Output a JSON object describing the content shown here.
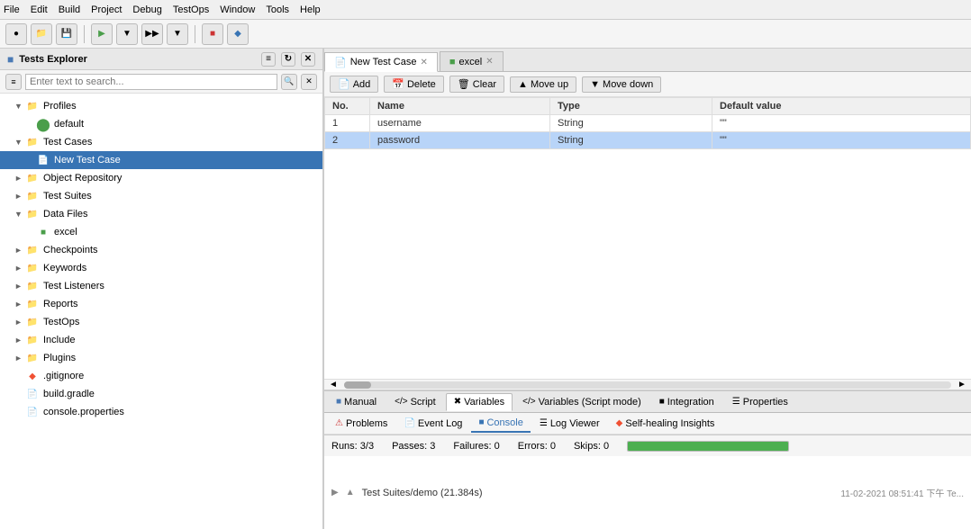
{
  "menubar": {
    "items": [
      "File",
      "Edit",
      "Build",
      "Project",
      "Debug",
      "TestOps",
      "Window",
      "Tools",
      "Help"
    ]
  },
  "left_panel": {
    "title": "Tests Explorer",
    "search_placeholder": "Enter text to search...",
    "tree": [
      {
        "id": "profiles",
        "label": "Profiles",
        "indent": 1,
        "expanded": true,
        "icon": "folder",
        "has_arrow": true
      },
      {
        "id": "default",
        "label": "default",
        "indent": 2,
        "expanded": false,
        "icon": "default-dot",
        "has_arrow": false
      },
      {
        "id": "test-cases",
        "label": "Test Cases",
        "indent": 1,
        "expanded": true,
        "icon": "folder",
        "has_arrow": true
      },
      {
        "id": "new-test-case",
        "label": "New Test Case",
        "indent": 2,
        "expanded": false,
        "icon": "testcase",
        "has_arrow": false,
        "selected": true
      },
      {
        "id": "object-repository",
        "label": "Object Repository",
        "indent": 1,
        "expanded": false,
        "icon": "folder",
        "has_arrow": true
      },
      {
        "id": "test-suites",
        "label": "Test Suites",
        "indent": 1,
        "expanded": false,
        "icon": "folder",
        "has_arrow": true
      },
      {
        "id": "data-files",
        "label": "Data Files",
        "indent": 1,
        "expanded": true,
        "icon": "folder",
        "has_arrow": true
      },
      {
        "id": "excel",
        "label": "excel",
        "indent": 2,
        "expanded": false,
        "icon": "excel",
        "has_arrow": false
      },
      {
        "id": "checkpoints",
        "label": "Checkpoints",
        "indent": 1,
        "expanded": false,
        "icon": "folder",
        "has_arrow": true
      },
      {
        "id": "keywords",
        "label": "Keywords",
        "indent": 1,
        "expanded": false,
        "icon": "folder",
        "has_arrow": true
      },
      {
        "id": "test-listeners",
        "label": "Test Listeners",
        "indent": 1,
        "expanded": false,
        "icon": "folder",
        "has_arrow": true
      },
      {
        "id": "reports",
        "label": "Reports",
        "indent": 1,
        "expanded": false,
        "icon": "folder",
        "has_arrow": true
      },
      {
        "id": "testops",
        "label": "TestOps",
        "indent": 1,
        "expanded": false,
        "icon": "folder",
        "has_arrow": true
      },
      {
        "id": "include",
        "label": "Include",
        "indent": 1,
        "expanded": false,
        "icon": "folder",
        "has_arrow": true
      },
      {
        "id": "plugins",
        "label": "Plugins",
        "indent": 1,
        "expanded": false,
        "icon": "folder",
        "has_arrow": true
      },
      {
        "id": "gitignore",
        "label": ".gitignore",
        "indent": 1,
        "expanded": false,
        "icon": "git",
        "has_arrow": false
      },
      {
        "id": "build-gradle",
        "label": "build.gradle",
        "indent": 1,
        "expanded": false,
        "icon": "gradle",
        "has_arrow": false
      },
      {
        "id": "console-properties",
        "label": "console.properties",
        "indent": 1,
        "expanded": false,
        "icon": "properties",
        "has_arrow": false
      }
    ]
  },
  "tabs": [
    {
      "id": "new-test-case-tab",
      "label": "New Test Case",
      "icon": "testcase",
      "active": true,
      "closeable": true
    },
    {
      "id": "excel-tab",
      "label": "excel",
      "icon": "excel",
      "active": false,
      "closeable": true
    }
  ],
  "content_toolbar": {
    "buttons": [
      "Add",
      "Delete",
      "Clear",
      "Move up",
      "Move down"
    ]
  },
  "table": {
    "columns": [
      "No.",
      "Name",
      "Type",
      "Default value"
    ],
    "rows": [
      {
        "no": "1",
        "name": "username",
        "type": "String",
        "default_value": "\"\""
      },
      {
        "no": "2",
        "name": "password",
        "type": "String",
        "default_value": "\"\""
      }
    ]
  },
  "bottom_tabs": {
    "row1": [
      "Manual",
      "Script",
      "Variables",
      "Variables (Script mode)",
      "Integration",
      "Properties"
    ]
  },
  "bottom_tabs2": {
    "row2": [
      "Problems",
      "Event Log",
      "Console",
      "Log Viewer",
      "Self-healing Insights"
    ]
  },
  "status_bar": {
    "runs_label": "Runs: 3/3",
    "passes_label": "Passes: 3",
    "failures_label": "Failures: 0",
    "errors_label": "Errors: 0",
    "skips_label": "Skips: 0",
    "progress": 100
  },
  "log_entry": {
    "text": "Test Suites/demo (21.384s)",
    "timestamp": "11-02-2021 08:51:41 下午 Te..."
  },
  "icons": {
    "folder": "📁",
    "testcase": "📋",
    "default_dot": "●",
    "excel": "📊",
    "git": "⚙",
    "gradle": "📄",
    "properties": "📄",
    "add": "+",
    "delete": "✕",
    "clear": "🗑",
    "move_up": "▲",
    "move_down": "▼"
  }
}
